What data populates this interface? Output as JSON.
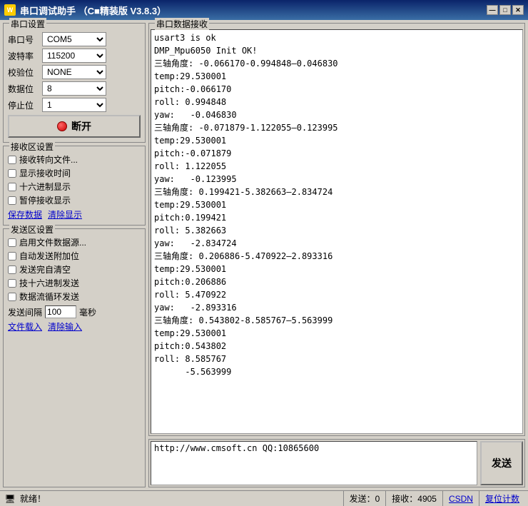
{
  "titlebar": {
    "icon": "W",
    "title": "串口调试助手  （C■精装版 V3.8.3）",
    "btn_min": "—",
    "btn_max": "□",
    "btn_close": "✕"
  },
  "serial_settings": {
    "group_title": "串口设置",
    "port_label": "串口号",
    "port_value": "COM5",
    "baud_label": "波特率",
    "baud_value": "115200",
    "parity_label": "校验位",
    "parity_value": "NONE",
    "data_label": "数据位",
    "data_value": "8",
    "stop_label": "停止位",
    "stop_value": "1",
    "disconnect_btn": "断开"
  },
  "receive_settings": {
    "group_title": "接收区设置",
    "cb1": "接收转向文件...",
    "cb2": "显示接收时间",
    "cb3": "十六进制显示",
    "cb4": "暂停接收显示",
    "save_data": "保存数据",
    "clear_display": "清除显示"
  },
  "send_settings": {
    "group_title": "发送区设置",
    "cb1": "启用文件数据源...",
    "cb2": "自动发送附加位",
    "cb3": "发送完自清空",
    "cb4": "技十六进制发送",
    "cb5": "数据流循环发送",
    "interval_label": "发送间隔",
    "interval_value": "100",
    "interval_unit": "毫秒",
    "load_file": "文件载入",
    "clear_input": "清除输入"
  },
  "receive_area": {
    "group_title": "串口数据接收",
    "content": "usart3 is ok\nDMP_Mpu6050 Init OK!\n三轴角度: -0.066170-0.994848—0.046830\ntemp:29.530001\npitch:-0.066170\nroll: 0.994848\nyaw:   -0.046830\n三轴角度: -0.071879-1.122055—0.123995\ntemp:29.530001\npitch:-0.071879\nroll: 1.122055\nyaw:   -0.123995\n三轴角度: 0.199421-5.382663—2.834724\ntemp:29.530001\npitch:0.199421\nroll: 5.382663\nyaw:   -2.834724\n三轴角度: 0.206886-5.470922—2.893316\ntemp:29.530001\npitch:0.206886\nroll: 5.470922\nyaw:   -2.893316\n三轴角度: 0.543802-8.585767—5.563999\ntemp:29.530001\npitch:0.543802\nroll: 8.585767\n      -5.563999"
  },
  "send_area": {
    "input_value": "http://www.cmsoft.cn QQ:10865600",
    "send_btn": "发送"
  },
  "statusbar": {
    "icon": "🖥",
    "status": "就绪！",
    "tx_label": "发送：0",
    "rx_label": "接收：4905",
    "reset_label": "复位计数",
    "extra": "CSDN"
  }
}
